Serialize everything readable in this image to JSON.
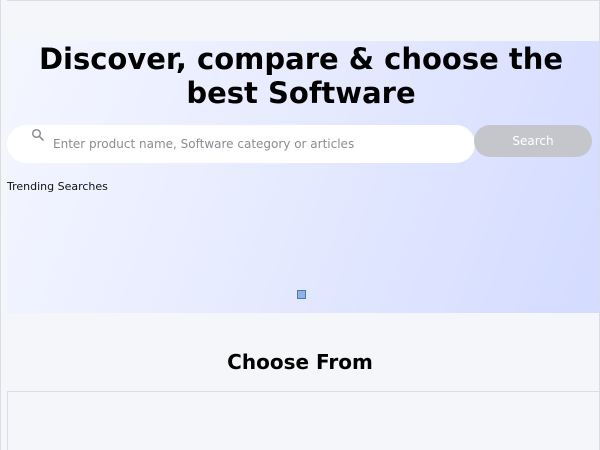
{
  "hero": {
    "title": "Discover, compare & choose the best Software",
    "search": {
      "placeholder": "Enter product name, Software category or articles",
      "value": "",
      "button_label": "Search"
    },
    "trending_label": "Trending Searches"
  },
  "choose_section": {
    "title": "Choose From"
  },
  "colors": {
    "search_button_bg": "#c4c6cc",
    "hero_gradient_end": "#d3dbff"
  }
}
